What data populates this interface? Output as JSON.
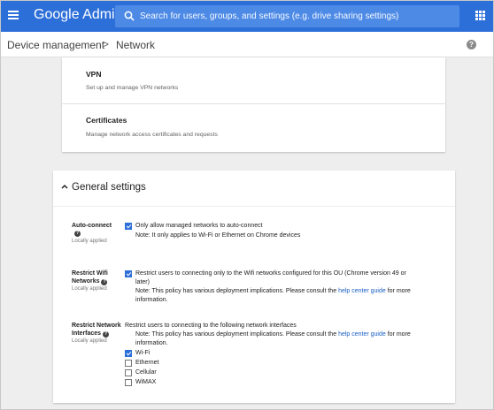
{
  "header": {
    "brand": "Google Admin",
    "search_placeholder": "Search for users, groups, and settings (e.g. drive sharing settings)"
  },
  "breadcrumb": {
    "parent": "Device management",
    "separator": ">",
    "current": "Network"
  },
  "network_items": [
    {
      "title": "VPN",
      "description": "Set up and manage VPN networks"
    },
    {
      "title": "Certificates",
      "description": "Manage network access certificates and requests"
    }
  ],
  "general_settings": {
    "title": "General settings",
    "auto_connect": {
      "label": "Auto-connect",
      "status": "Locally applied",
      "option": "Only allow managed networks to auto-connect",
      "checked": true,
      "note": "Note: It only applies to Wi-Fi or Ethernet on Chrome devices"
    },
    "restrict_wifi": {
      "label_line1": "Restrict Wifi",
      "label_line2": "Networks",
      "status": "Locally applied",
      "option_line1": "Restrict users to connecting only to the Wifi networks configured for this OU (Chrome version 49 or",
      "option_line2": "later)",
      "checked": true,
      "note_prefix": "Note: This policy has various deployment implications. Please consult the",
      "note_link": "help center guide",
      "note_suffix": "for more",
      "note_line2": "information."
    },
    "restrict_interfaces": {
      "label_line1": "Restrict Network",
      "label_line2": "Interfaces",
      "status": "Locally applied",
      "intro": "Restrict users to connecting to the following network interfaces",
      "note_prefix": "Note: This policy has various deployment implications. Please consult the",
      "note_link": "help center guide",
      "note_suffix": "for more",
      "note_line2": "information.",
      "options": [
        {
          "label": "Wi-Fi",
          "checked": true
        },
        {
          "label": "Ethernet",
          "checked": false
        },
        {
          "label": "Cellular",
          "checked": false
        },
        {
          "label": "WiMAX",
          "checked": false
        }
      ]
    }
  },
  "colors": {
    "accent": "#2d6fd9",
    "link": "#1a5fc4"
  }
}
